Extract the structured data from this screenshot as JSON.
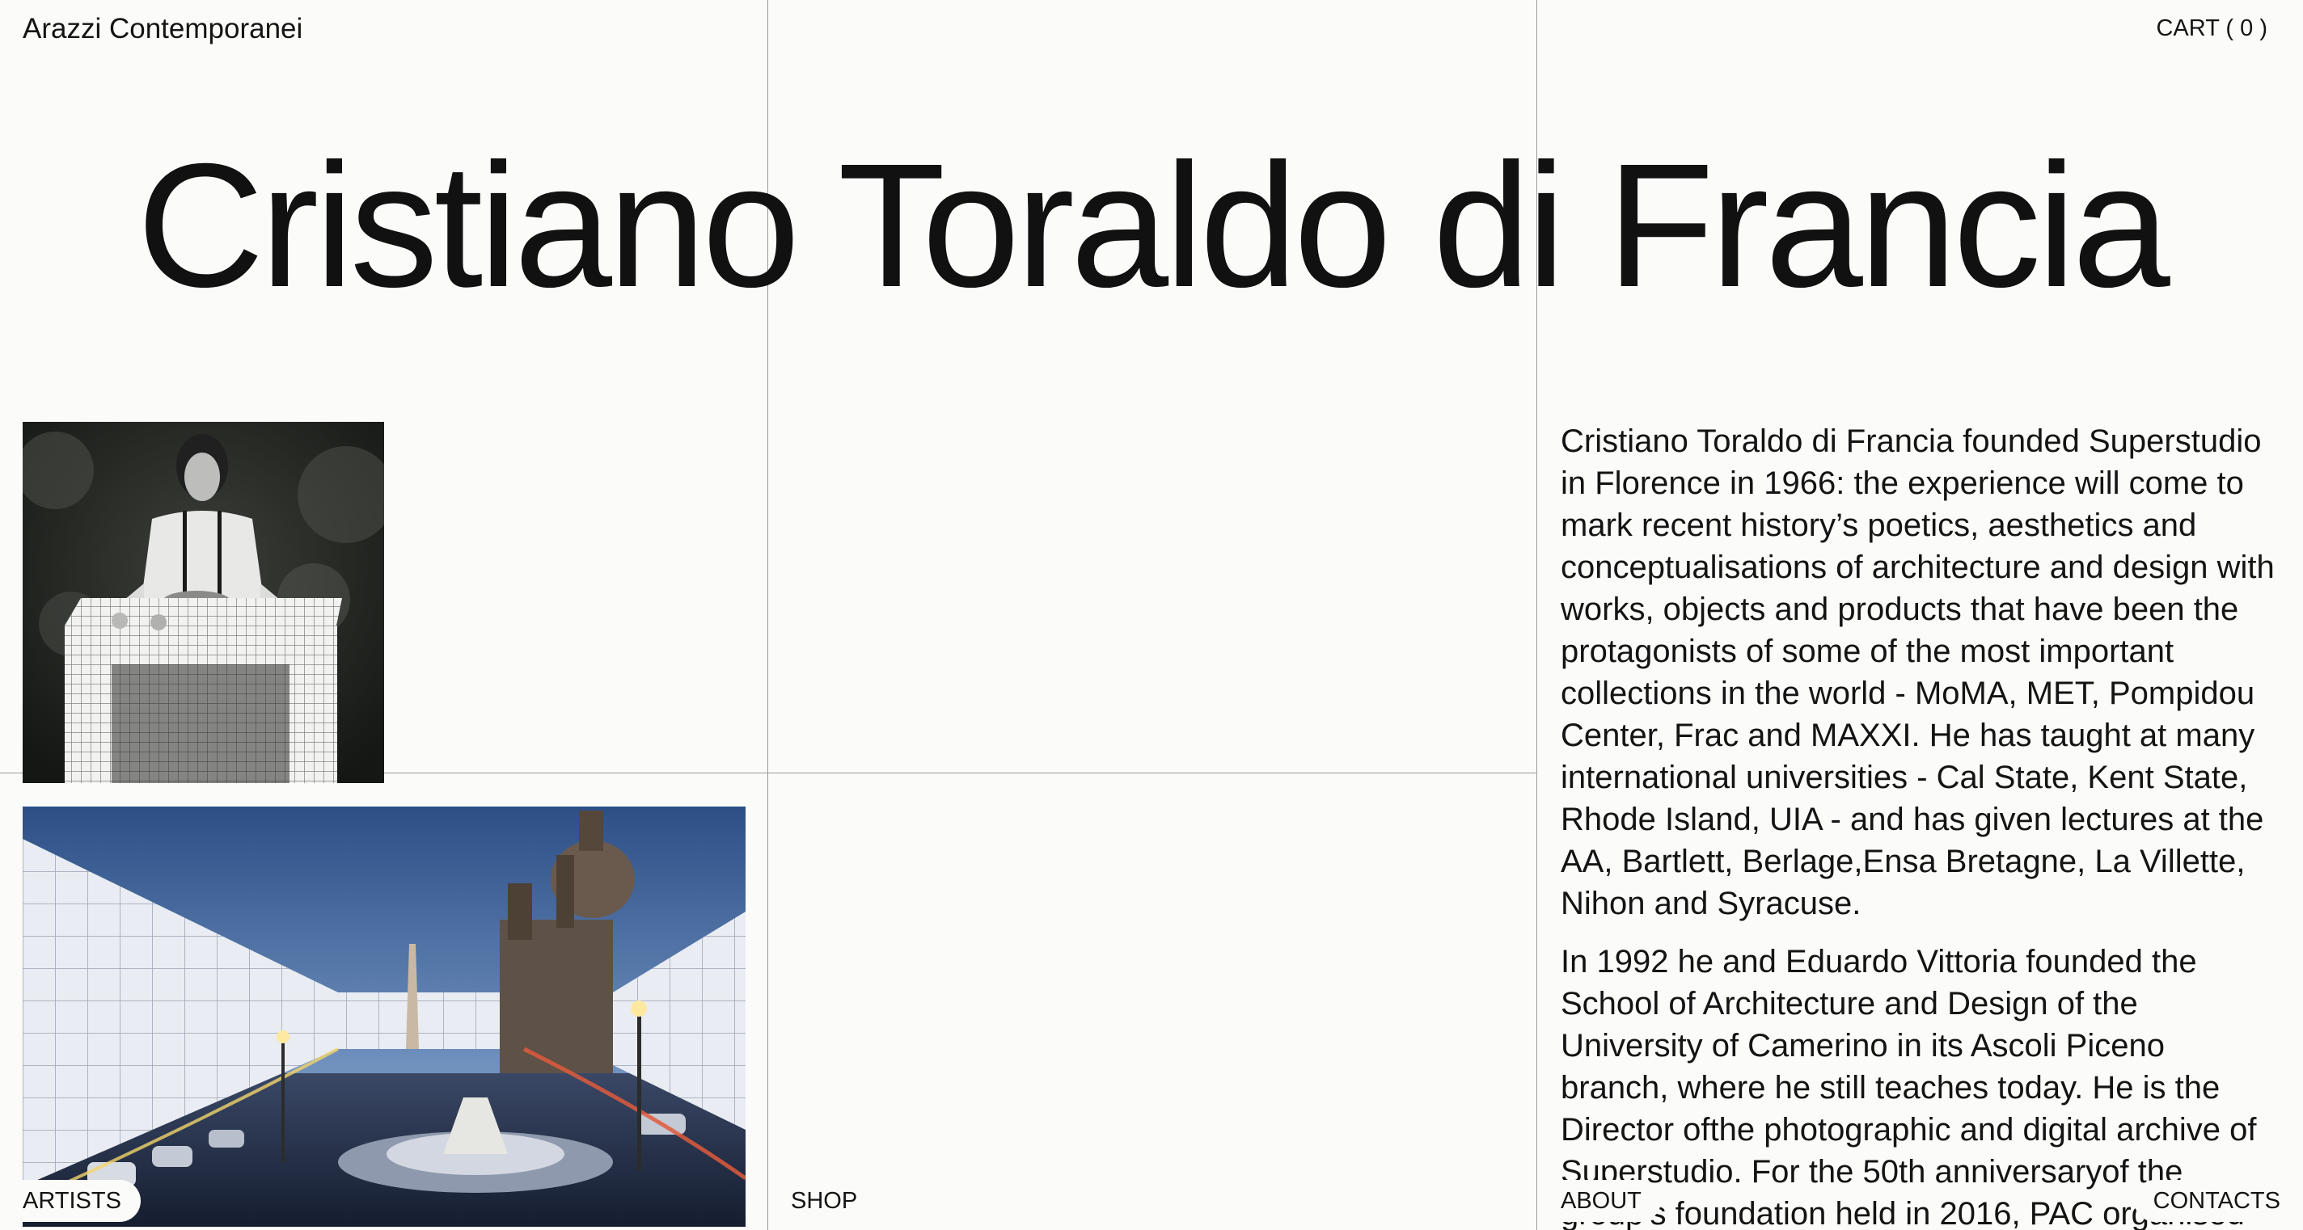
{
  "header": {
    "brand": "Arazzi Contemporanei",
    "cart_label": "CART ( 0 )"
  },
  "hero": {
    "title": "Cristiano Toraldo di Francia"
  },
  "images": [
    {
      "name": "portrait-photo",
      "alt": "black and white photo of man at gridded table"
    },
    {
      "name": "piazza-photo",
      "alt": "collage of Piazza Navona with gridded walls"
    }
  ],
  "bio": {
    "paragraphs": [
      "Cristiano Toraldo di Francia founded Superstudio in Florence in 1966: the experience will come to mark recent history’s poetics, aesthetics and conceptualisations of architecture and design with works, objects and products that have been the protagonists of some of the most important collections in the world - MoMA, MET, Pompidou Center, Frac and MAXXI. He has taught at many international universities - Cal State, Kent State, Rhode Island, UIA - and has given lectures at the AA, Bartlett, Berlage,Ensa Bretagne, La Villette, Nihon and Syracuse.",
      "In 1992 he and Eduardo Vittoria founded the School of Architecture and Design of the University of Camerino in its Ascoli Piceno branch, where he still teaches today. He is the Director ofthe photographic and digital archive of Superstudio. For the 50th anniversaryof the group’s foundation held in 2016, PAC organised"
    ]
  },
  "nav": {
    "artists": "ARTISTS",
    "shop": "SHOP",
    "about": "ABOUT",
    "contacts": "CONTACTS"
  }
}
